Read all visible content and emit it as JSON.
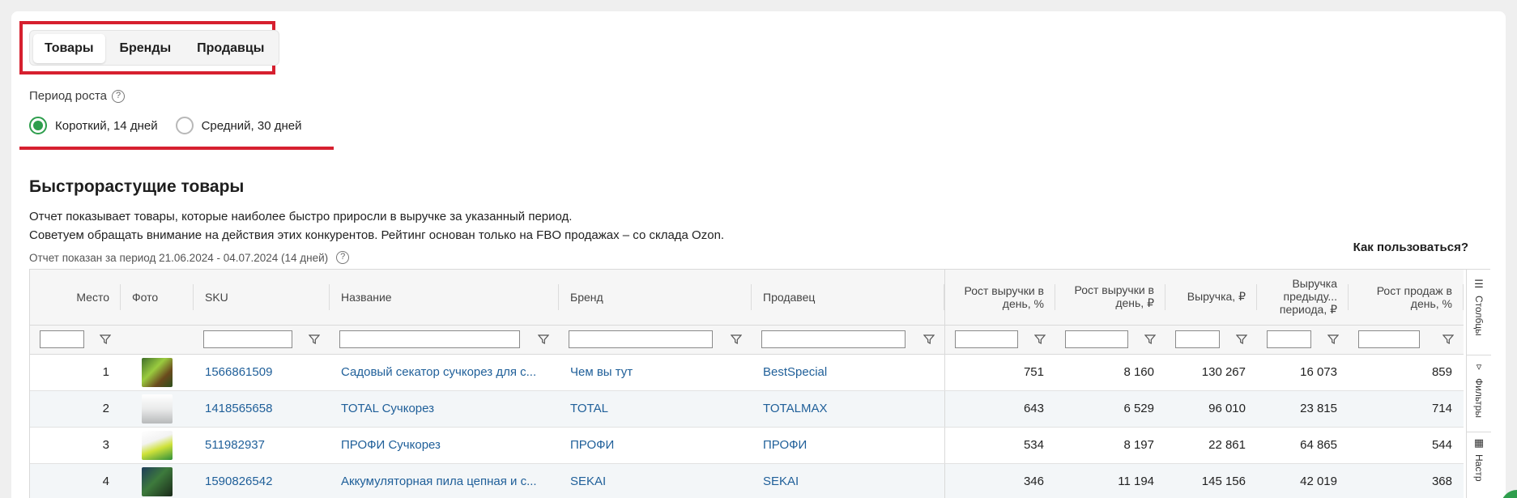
{
  "tabs": [
    {
      "label": "Товары",
      "active": true
    },
    {
      "label": "Бренды",
      "active": false
    },
    {
      "label": "Продавцы",
      "active": false
    }
  ],
  "period": {
    "label": "Период роста",
    "options": [
      {
        "label": "Короткий, 14 дней",
        "checked": true
      },
      {
        "label": "Средний, 30 дней",
        "checked": false
      }
    ]
  },
  "section": {
    "title": "Быстрорастущие товары",
    "desc_line1": "Отчет показывает товары, которые наиболее быстро приросли в выручке за указанный период.",
    "desc_line2": "Советуем обращать внимание на действия этих конкурентов. Рейтинг основан только на FBO продажах – со склада Ozon.",
    "period_note": "Отчет показан за период 21.06.2024 - 04.07.2024 (14 дней)",
    "how_to": "Как пользоваться?"
  },
  "table": {
    "headers": {
      "place": "Место",
      "photo": "Фото",
      "sku": "SKU",
      "name": "Название",
      "brand": "Бренд",
      "seller": "Продавец",
      "growth_pct": "Рост выручки в день, %",
      "growth_rub": "Рост выручки в день, ₽",
      "revenue": "Выручка, ₽",
      "prev_revenue": "Выручка предыду... периода, ₽",
      "sales_growth": "Рост продаж в день, %"
    },
    "rows": [
      {
        "place": "1",
        "sku": "1566861509",
        "name": "Садовый секатор сучкорез для с...",
        "brand": "Чем вы тут",
        "seller": "BestSpecial",
        "growth_pct": "751",
        "growth_rub": "8 160",
        "revenue": "130 267",
        "prev_revenue": "16 073",
        "sales_growth": "859"
      },
      {
        "place": "2",
        "sku": "1418565658",
        "name": "TOTAL Сучкорез",
        "brand": "TOTAL",
        "seller": "TOTALMAX",
        "growth_pct": "643",
        "growth_rub": "6 529",
        "revenue": "96 010",
        "prev_revenue": "23 815",
        "sales_growth": "714"
      },
      {
        "place": "3",
        "sku": "511982937",
        "name": "ПРОФИ Сучкорез",
        "brand": "ПРОФИ",
        "seller": "ПРОФИ",
        "growth_pct": "534",
        "growth_rub": "8 197",
        "revenue": "22 861",
        "prev_revenue": "64 865",
        "sales_growth": "544"
      },
      {
        "place": "4",
        "sku": "1590826542",
        "name": "Аккумуляторная пила цепная и с...",
        "brand": "SEKAI",
        "seller": "SEKAI",
        "growth_pct": "346",
        "growth_rub": "11 194",
        "revenue": "145 156",
        "prev_revenue": "42 019",
        "sales_growth": "368"
      }
    ]
  },
  "side_panel": {
    "columns": "Столбцы",
    "filters": "Фильтры",
    "settings": "Настр"
  },
  "colors": {
    "accent": "#2e9e4d",
    "highlight": "#d6202f",
    "link": "#1f5f99"
  }
}
